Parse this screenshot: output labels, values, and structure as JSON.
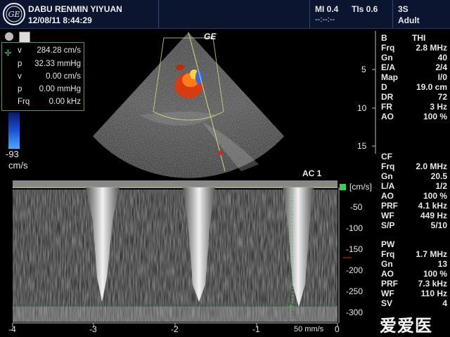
{
  "header": {
    "hospital": "DABU RENMIN YIYUAN",
    "datetime": "12/08/11 8:44:29",
    "mi_label": "MI 0.4",
    "mi_sub": "--:--:--",
    "tis_label": "TIs 0.6",
    "probe": "3S",
    "preset": "Adult"
  },
  "logo_icon": "ge-logo",
  "sector_label": "GE",
  "measurements": [
    {
      "label": "v",
      "value": "284.28 cm/s"
    },
    {
      "label": "p",
      "value": "32.33 mmHg"
    },
    {
      "label": "v",
      "value": "0.00 cm/s"
    },
    {
      "label": "p",
      "value": "0.00 mmHg"
    },
    {
      "label": "Frq",
      "value": "0.00 kHz"
    }
  ],
  "colorbar": {
    "min": "-93",
    "unit": "cm/s"
  },
  "depth_scale": [
    "5",
    "10",
    "15"
  ],
  "bmode": {
    "title": "B",
    "title_value": "THI",
    "params": [
      {
        "label": "Frq",
        "value": "2.8 MHz"
      },
      {
        "label": "Gn",
        "value": "40"
      },
      {
        "label": "E/A",
        "value": "2/4"
      },
      {
        "label": "Map",
        "value": "I/0"
      },
      {
        "label": "D",
        "value": "19.0 cm"
      },
      {
        "label": "DR",
        "value": "72"
      },
      {
        "label": "FR",
        "value": "3 Hz"
      },
      {
        "label": "AO",
        "value": "100 %"
      }
    ]
  },
  "cf": {
    "title": "CF",
    "params": [
      {
        "label": "Frq",
        "value": "2.0 MHz"
      },
      {
        "label": "Gn",
        "value": "20.5"
      },
      {
        "label": "L/A",
        "value": "1/2"
      },
      {
        "label": "AO",
        "value": "100 %"
      },
      {
        "label": "PRF",
        "value": "4.1 kHz"
      },
      {
        "label": "WF",
        "value": "449 Hz"
      },
      {
        "label": "S/P",
        "value": "5/10"
      }
    ]
  },
  "pw": {
    "title": "PW",
    "params": [
      {
        "label": "Frq",
        "value": "1.7 MHz"
      },
      {
        "label": "Gn",
        "value": "13"
      },
      {
        "label": "AO",
        "value": "100 %"
      },
      {
        "label": "PRF",
        "value": "7.3 kHz"
      },
      {
        "label": "WF",
        "value": "110 Hz"
      },
      {
        "label": "SV",
        "value": "4"
      }
    ]
  },
  "spectral": {
    "ac_label": "AC 1",
    "unit": "[cm/s]",
    "y_ticks": [
      "-50",
      "-100",
      "-150",
      "-200",
      "-250",
      "-300"
    ],
    "x_ticks": [
      "-4",
      "-3",
      "-2",
      "-1",
      "0"
    ],
    "sweep_speed": "50 mm/s"
  },
  "watermark": "爱爱医"
}
